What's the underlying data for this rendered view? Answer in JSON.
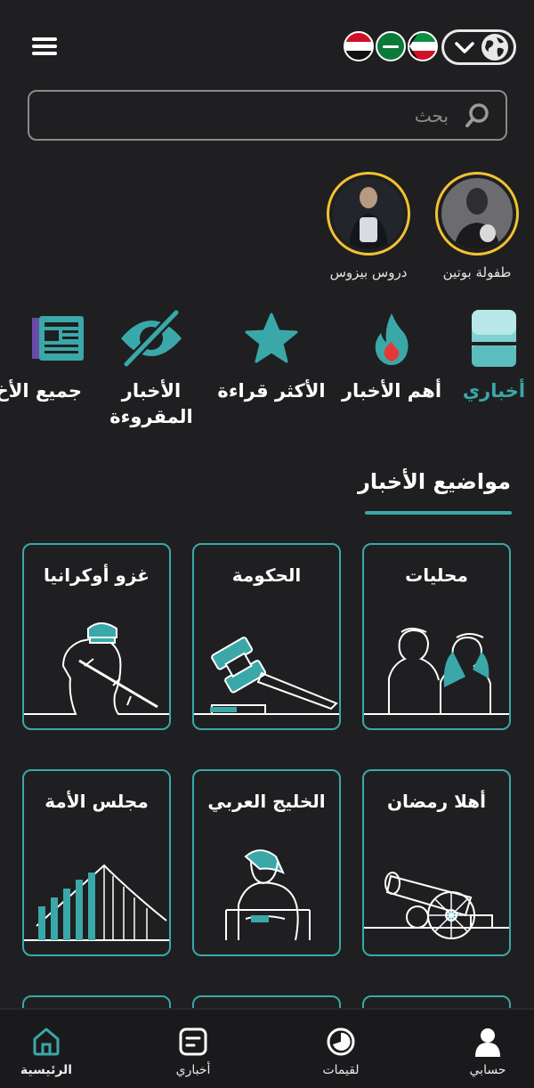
{
  "search": {
    "placeholder": "بحث"
  },
  "stories": [
    {
      "caption": "طفولة بوتين"
    },
    {
      "caption": "دروس بيزوس"
    }
  ],
  "categories": [
    {
      "label": "أخباري",
      "color": "#3aa8a8"
    },
    {
      "label": "أهم الأخبار"
    },
    {
      "label": "الأكثر قراءة"
    },
    {
      "label": "الأخبار المقروءة"
    },
    {
      "label": "جميع الأخ"
    }
  ],
  "section": {
    "title": "مواضيع الأخبار"
  },
  "topics": [
    {
      "label": "محليات"
    },
    {
      "label": "الحكومة"
    },
    {
      "label": "غزو أوكرانيا"
    },
    {
      "label": "أهلا رمضان"
    },
    {
      "label": "الخليج العربي"
    },
    {
      "label": "مجلس الأمة"
    }
  ],
  "nav": {
    "account": "حسابي",
    "values": "لقيمات",
    "my_news": "أخباري",
    "home": "الرئيسية"
  },
  "colors": {
    "accent": "#3aa8a8",
    "background": "#1f1f21",
    "story_ring": "#f2c232"
  }
}
